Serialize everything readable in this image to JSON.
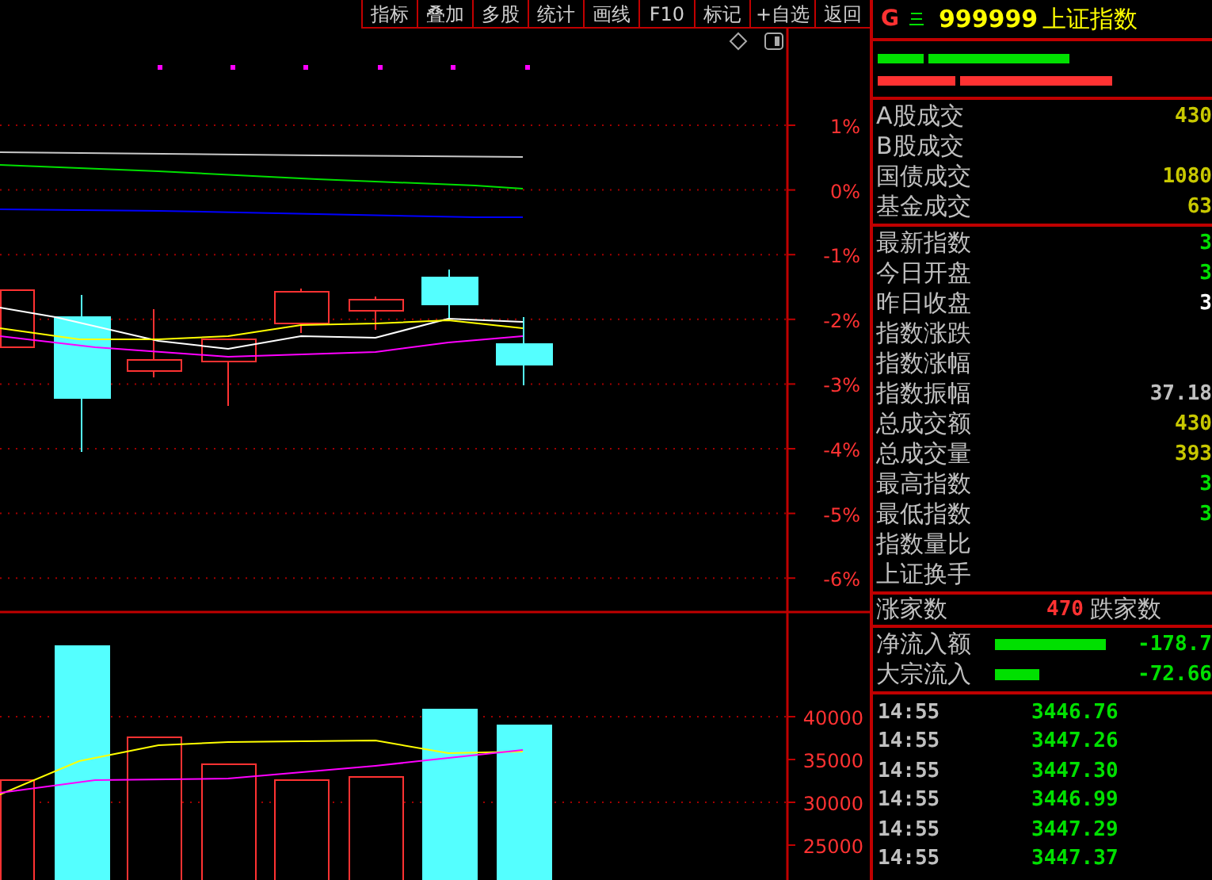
{
  "toolbar": {
    "buttons": [
      "指标",
      "叠加",
      "多股",
      "统计",
      "画线",
      "F10",
      "标记",
      "+自选",
      "返回"
    ]
  },
  "price_chart": {
    "axis_labels": [
      "1%",
      "0%",
      "-1%",
      "-2%",
      "-3%",
      "-4%",
      "-5%",
      "-6%"
    ]
  },
  "volume_chart": {
    "axis_labels": [
      "40000",
      "35000",
      "30000",
      "25000"
    ]
  },
  "quote_header": {
    "marker": "G",
    "code": "999999",
    "name": "上证指数"
  },
  "turnover": [
    {
      "label": "A股成交",
      "value": "430",
      "color": "#c8c800"
    },
    {
      "label": "B股成交"
    },
    {
      "label": "国债成交",
      "value": "1080",
      "color": "#c8c800"
    },
    {
      "label": "基金成交",
      "value": "63",
      "color": "#c8c800"
    }
  ],
  "index_stats": [
    {
      "label": "最新指数",
      "value": "3",
      "color": "#00e000"
    },
    {
      "label": "今日开盘",
      "value": "3",
      "color": "#00e000"
    },
    {
      "label": "昨日收盘",
      "value": "3",
      "color": "#ffffff"
    },
    {
      "label": "指数涨跌"
    },
    {
      "label": "指数涨幅"
    },
    {
      "label": "指数振幅",
      "value": "37.18",
      "color": "#c0c0c0"
    },
    {
      "label": "总成交额",
      "value": "430",
      "color": "#c8c800"
    },
    {
      "label": "总成交量",
      "value": "393",
      "color": "#c8c800"
    },
    {
      "label": "最高指数",
      "value": "3",
      "color": "#00e000"
    },
    {
      "label": "最低指数",
      "value": "3",
      "color": "#00e000"
    },
    {
      "label": "指数量比"
    },
    {
      "label": "上证换手"
    }
  ],
  "breadth": {
    "advancing_label": "涨家数",
    "advancing": "470",
    "declining_label": "跌家数"
  },
  "flows": [
    {
      "label": "净流入额",
      "value": "-178.7"
    },
    {
      "label": "大宗流入",
      "value": "-72.66"
    }
  ],
  "ticks": [
    {
      "time": "14:55",
      "price": "3446.76"
    },
    {
      "time": "14:55",
      "price": "3447.26"
    },
    {
      "time": "14:55",
      "price": "3447.30"
    },
    {
      "time": "14:55",
      "price": "3446.99"
    },
    {
      "time": "14:55",
      "price": "3447.29"
    },
    {
      "time": "14:55",
      "price": "3447.37"
    }
  ]
}
